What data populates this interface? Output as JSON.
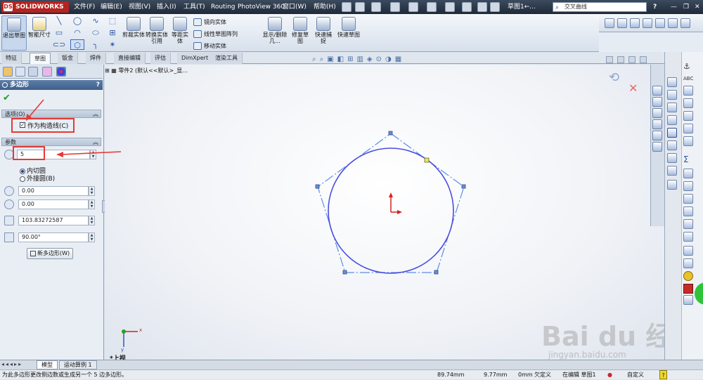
{
  "titlebar": {
    "logo": "SOLIDWORKS",
    "logo_mark": "DS",
    "menus": [
      "文件(F)",
      "编辑(E)",
      "视图(V)",
      "插入(I)",
      "工具(T)",
      "Routing",
      "PhotoView 360",
      "窗口(W)",
      "帮助(H)"
    ],
    "doc_title": "草图1←...",
    "search_placeholder": "交叉曲线",
    "help_label": "?"
  },
  "commandmanager": {
    "exit_sketch": "退出草图",
    "smart_dim": "智能尺寸",
    "trim": "剪裁实体",
    "convert": "转换实体引用",
    "offset": "等距实体",
    "mirror": "镜向实体",
    "linear_pattern": "线性草图阵列",
    "move": "移动实体",
    "display_delete": "显示/删除几...",
    "repair": "修复草图",
    "quick_snaps": "快速捕捉",
    "rapid_sketch": "快速草图"
  },
  "tabs": [
    "特征",
    "草图",
    "钣金",
    "焊件",
    "直接编辑",
    "评估",
    "DimXpert",
    "渲染工具"
  ],
  "active_tab": "草图",
  "tree": {
    "item": "零件2 (默认<<默认>_显..."
  },
  "propertymanager": {
    "title": "多边形",
    "help": "?",
    "options_group": "选项(O)",
    "construction_label": "作为构造线(C)",
    "construction_checked": true,
    "params_group": "参数",
    "sides": "5",
    "inscribed_label": "内切圆",
    "circumscribed_label": "外接圆(B)",
    "inscribed_selected": true,
    "center_x": "0.00",
    "center_y": "0.00",
    "diameter": "103.83272587",
    "angle": "90.00°",
    "new_polygon": "新多边形(W)"
  },
  "viewport": {
    "view_label": "*上视",
    "triad_x": "x",
    "triad_y": "y"
  },
  "bottom_tabs": [
    "模型",
    "运动算例 1"
  ],
  "status": {
    "message": "为此多边形更改侧边数或生成另一个 5 边多边形。",
    "x": "89.74mm",
    "y": "9.77mm",
    "z": "0mm",
    "state": "欠定义",
    "editing": "在编辑 草图1",
    "custom": "自定义"
  },
  "watermark": {
    "text": "Bai du 经验",
    "url": "jingyan.baidu.com"
  },
  "colors": {
    "sketch_blue": "#4a4de0",
    "construction_blue": "#5b8de8",
    "annotation_red": "#e53a34",
    "origin_red": "#d42020"
  }
}
